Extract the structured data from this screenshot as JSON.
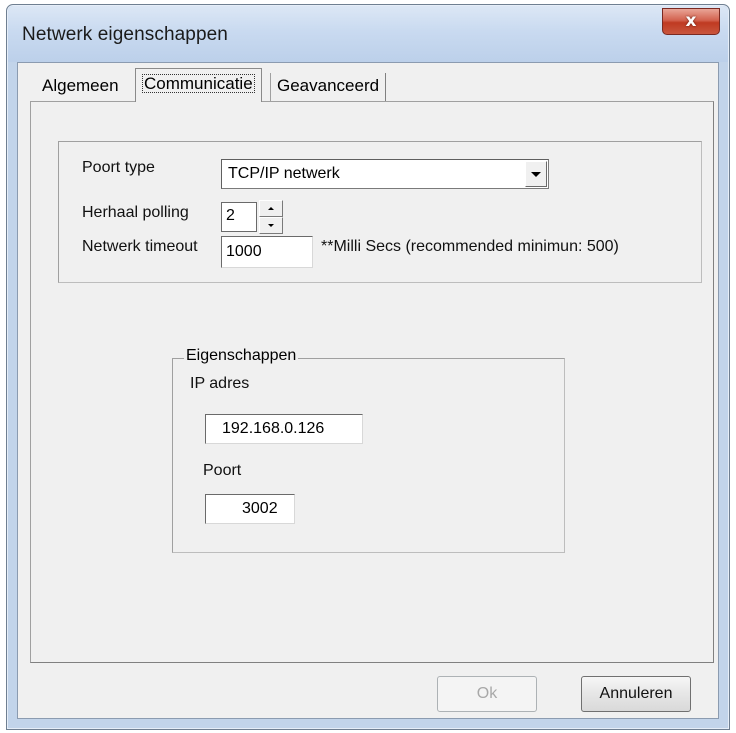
{
  "window": {
    "title": "Netwerk eigenschappen",
    "close_label": "x"
  },
  "tabs": [
    {
      "label": "Algemeen",
      "active": false
    },
    {
      "label": "Communicatie",
      "active": true
    },
    {
      "label": "Geavanceerd",
      "active": false
    }
  ],
  "communication": {
    "port_type_label": "Poort type",
    "port_type_value": "TCP/IP netwerk",
    "polling_label": "Herhaal polling",
    "polling_value": "2",
    "timeout_label": "Netwerk timeout",
    "timeout_value": "1000",
    "timeout_note": "**Milli Secs (recommended minimun: 500)"
  },
  "properties": {
    "legend": "Eigenschappen",
    "ip_label": "IP adres",
    "ip_value": "192.168.0.126",
    "port_label": "Poort",
    "port_value": "3002"
  },
  "buttons": {
    "ok_label": "Ok",
    "ok_enabled": false,
    "cancel_label": "Annuleren"
  },
  "colors": {
    "close_button": "#c9563d",
    "window_frame": "#c2d4ea",
    "dialog_background": "#f0f0f0"
  }
}
